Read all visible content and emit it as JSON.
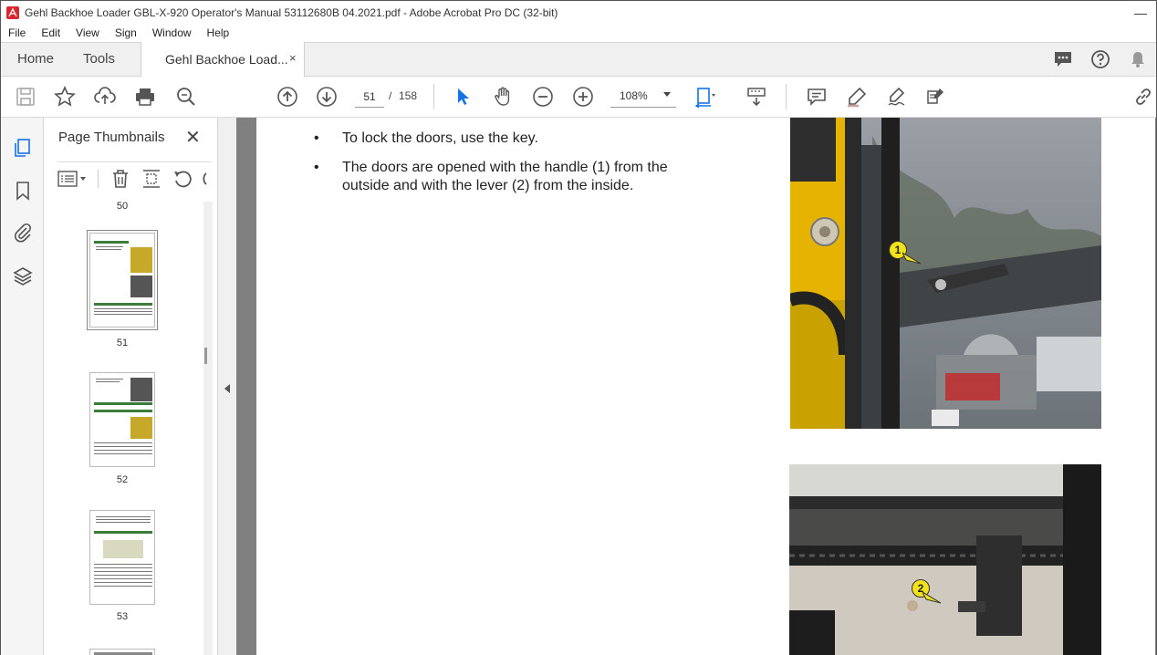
{
  "window": {
    "title": "Gehl Backhoe Loader GBL-X-920 Operator's Manual 53112680B 04.2021.pdf - Adobe Acrobat Pro DC (32-bit)",
    "minimize_icon": "minimize-icon"
  },
  "menu": [
    "File",
    "Edit",
    "View",
    "Sign",
    "Window",
    "Help"
  ],
  "tabs": {
    "home": "Home",
    "tools": "Tools",
    "document": "Gehl Backhoe Load...",
    "close_glyph": "×"
  },
  "toolbar": {
    "page_current": "51",
    "page_sep": "/",
    "page_total": "158",
    "zoom": "108%"
  },
  "thumbnails": {
    "title": "Page Thumbnails",
    "close_glyph": "✕",
    "pages": [
      "50",
      "51",
      "52",
      "53"
    ],
    "selected": "51"
  },
  "content": {
    "bullets": [
      "To lock the doors, use the key.",
      "The doors are opened with the handle (1) from the outside and with the lever (2) from the inside."
    ],
    "bullet_glyph": "•",
    "callouts": [
      "1",
      "2"
    ]
  },
  "colors": {
    "accent": "#1473e6",
    "acrobat_red": "#d7282f",
    "callout_yellow": "#f2e21a",
    "machine_yellow": "#e6b400"
  }
}
